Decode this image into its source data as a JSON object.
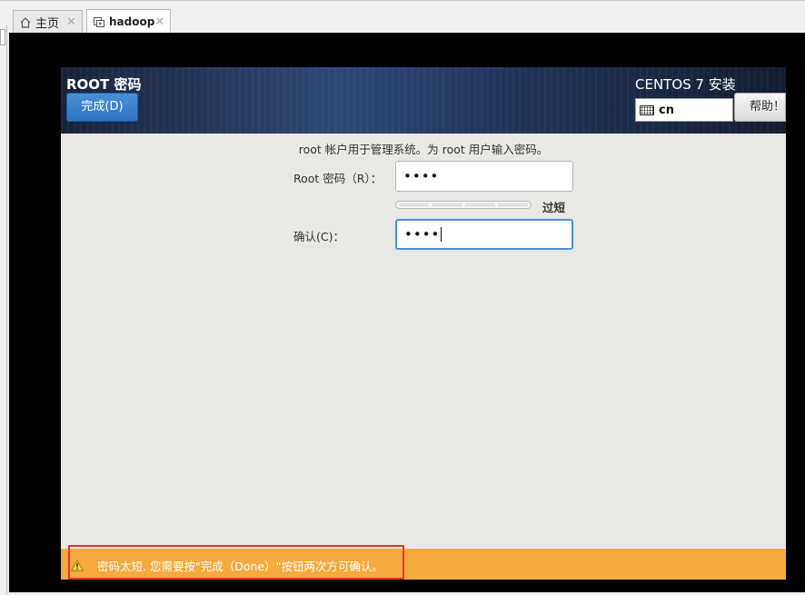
{
  "tabs": [
    {
      "label": "主页",
      "icon": "home-icon"
    },
    {
      "label": "hadoop",
      "icon": "vm-icon"
    }
  ],
  "header": {
    "spoke_title": "ROOT 密码",
    "done_label": "完成(D)",
    "product_title": "CENTOS 7 安装",
    "keyboard_layout": "cn",
    "help_label": "帮助！"
  },
  "form": {
    "description": "root 帐户用于管理系统。为 root 用户输入密码。",
    "root_label": "Root 密码（R）：",
    "root_value": "••••",
    "strength_text": "过短",
    "strength_level": 0,
    "confirm_label": "确认(C)：",
    "confirm_value": "••••"
  },
  "warning": {
    "text": "密码太短. 您需要按\"完成（Done）\"按钮两次方可确认。",
    "bar_color": "#f6aa3e"
  },
  "colors": {
    "accent": "#4a90d9",
    "highlight": "#e8322e"
  }
}
